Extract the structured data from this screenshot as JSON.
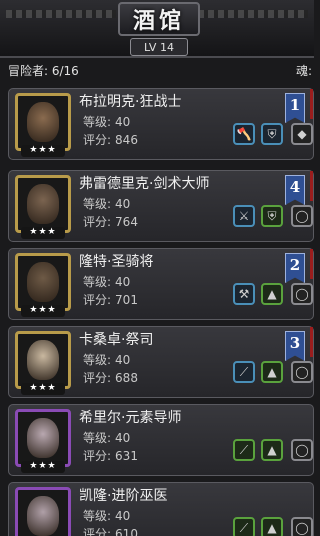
{
  "header": {
    "title": "酒馆",
    "level_badge": "LV 14",
    "adventurers_label": "冒险者: 6/16",
    "soul_label": "魂:"
  },
  "adventurers": [
    {
      "name": "布拉明克·狂战士",
      "level_label": "等级:",
      "level": "40",
      "score_label": "评分:",
      "score": "846",
      "stars": "★★★",
      "rank": "1",
      "frame_color": "#b89b4a",
      "skin_color": "#8a6b4f",
      "equipment": [
        {
          "icon": "axe-icon",
          "frame": "blue"
        },
        {
          "icon": "armor-icon",
          "frame": "blue"
        },
        {
          "icon": "gem-icon",
          "frame": "gray"
        }
      ]
    },
    {
      "name": "弗雷德里克·剑术大师",
      "level_label": "等级:",
      "level": "40",
      "score_label": "评分:",
      "score": "764",
      "stars": "★★★",
      "rank": "4",
      "frame_color": "#b89b4a",
      "skin_color": "#7b6450",
      "equipment": [
        {
          "icon": "sword-icon",
          "frame": "blue"
        },
        {
          "icon": "armor-icon",
          "frame": "green"
        },
        {
          "icon": "ring-icon",
          "frame": "gray"
        }
      ]
    },
    {
      "name": "隆特·圣骑将",
      "level_label": "等级:",
      "level": "40",
      "score_label": "评分:",
      "score": "701",
      "stars": "★★★",
      "rank": "2",
      "frame_color": "#b89b4a",
      "skin_color": "#6e5a46",
      "equipment": [
        {
          "icon": "mace-icon",
          "frame": "blue"
        },
        {
          "icon": "cloak-icon",
          "frame": "green"
        },
        {
          "icon": "ring-icon",
          "frame": "gray"
        }
      ]
    },
    {
      "name": "卡桑卓·祭司",
      "level_label": "等级:",
      "level": "40",
      "score_label": "评分:",
      "score": "688",
      "stars": "★★★",
      "rank": "3",
      "frame_color": "#b89b4a",
      "skin_color": "#c9b8a0",
      "equipment": [
        {
          "icon": "staff-icon",
          "frame": "blue"
        },
        {
          "icon": "cloak-icon",
          "frame": "green"
        },
        {
          "icon": "ring-icon",
          "frame": "gray"
        }
      ]
    },
    {
      "name": "希里尔·元素导师",
      "level_label": "等级:",
      "level": "40",
      "score_label": "评分:",
      "score": "631",
      "stars": "★★★",
      "rank": "",
      "frame_color": "#8a4bb5",
      "skin_color": "#b9a8b0",
      "equipment": [
        {
          "icon": "staff-icon",
          "frame": "green"
        },
        {
          "icon": "robe-icon",
          "frame": "green"
        },
        {
          "icon": "ring-icon",
          "frame": "gray"
        }
      ]
    },
    {
      "name": "凯隆·进阶巫医",
      "level_label": "等级:",
      "level": "40",
      "score_label": "评分:",
      "score": "610",
      "stars": "★★★",
      "rank": "",
      "frame_color": "#8a4bb5",
      "skin_color": "#b0a0a8",
      "equipment": [
        {
          "icon": "staff-icon",
          "frame": "green"
        },
        {
          "icon": "robe-icon",
          "frame": "green"
        },
        {
          "icon": "ring-icon",
          "frame": "gray"
        }
      ]
    }
  ]
}
